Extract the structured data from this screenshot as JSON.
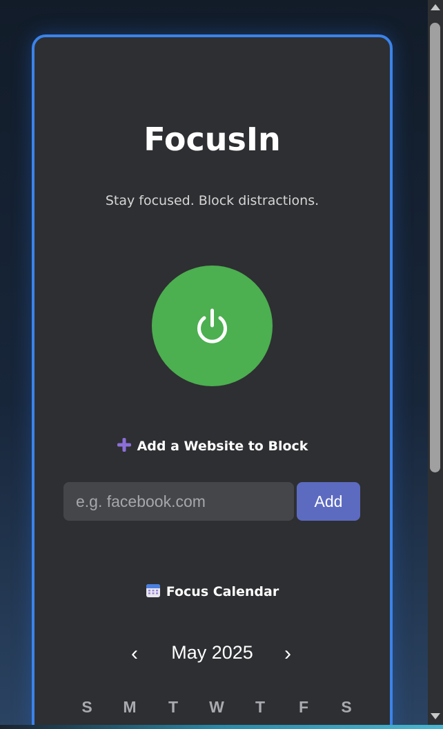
{
  "app": {
    "title": "FocusIn",
    "subtitle": "Stay focused. Block distractions."
  },
  "power_button": {
    "icon": "power-icon",
    "state": "on",
    "color": "#4caf50"
  },
  "block_section": {
    "heading": "Add a Website to Block",
    "icon": "plus-icon",
    "input_placeholder": "e.g. facebook.com",
    "input_value": "",
    "add_label": "Add"
  },
  "calendar": {
    "heading": "Focus Calendar",
    "icon": "calendar-icon",
    "prev_label": "‹",
    "next_label": "›",
    "month_label": "May 2025",
    "weekdays": [
      "S",
      "M",
      "T",
      "W",
      "T",
      "F",
      "S"
    ]
  },
  "colors": {
    "accent_border": "#3b83ea",
    "card_bg": "#2e2f32",
    "add_button": "#5c6bc0"
  }
}
